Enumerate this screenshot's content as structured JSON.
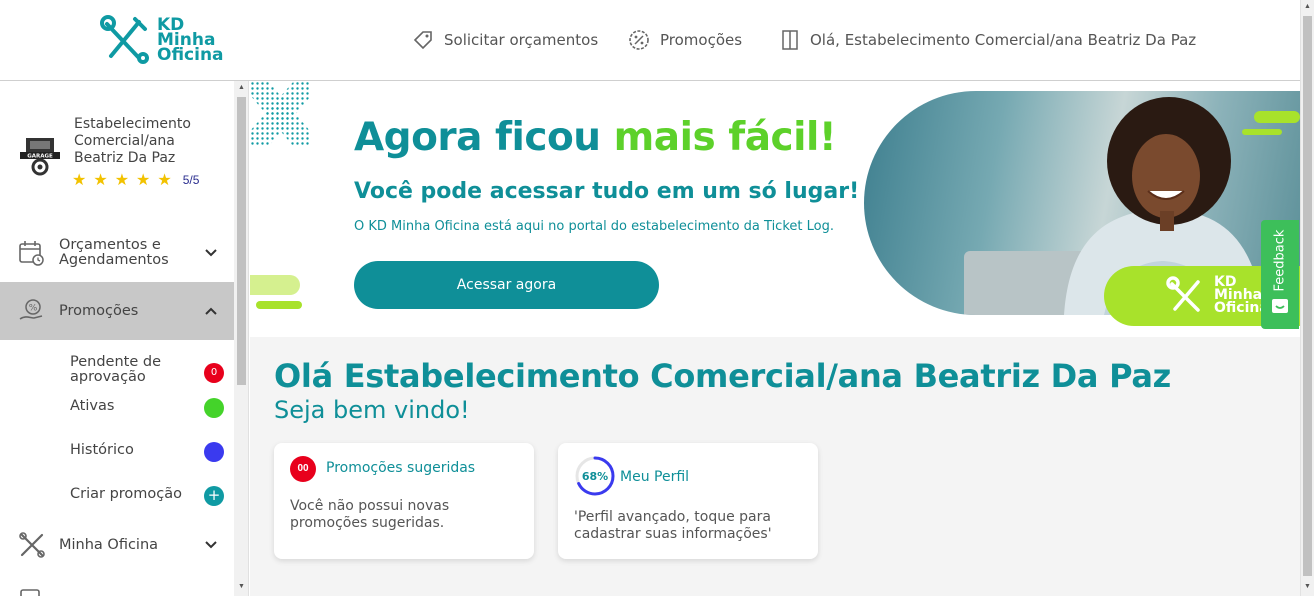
{
  "header": {
    "logo_text": "KD Minha Oficina",
    "nav": [
      {
        "label": "Solicitar orçamentos",
        "icon": "tag-icon"
      },
      {
        "label": "Promoções",
        "icon": "percent-badge-icon"
      },
      {
        "label": "Olá, Estabelecimento Comercial/ana Beatriz Da Paz",
        "icon": "door-icon"
      }
    ]
  },
  "sidebar": {
    "profile": {
      "name": "Estabelecimento Comercial/ana Beatriz Da Paz",
      "avatar_label": "GARAGE",
      "stars": 5,
      "rating": "5/5"
    },
    "menu": [
      {
        "label": "Orçamentos e Agendamentos",
        "icon": "calendar-icon",
        "expanded": false
      },
      {
        "label": "Promoções",
        "icon": "percent-hand-icon",
        "expanded": true
      },
      {
        "label": "Minha Oficina",
        "icon": "tools-icon",
        "expanded": false
      }
    ],
    "promo_sub": [
      {
        "label": "Pendente de aprovação",
        "badge": "0",
        "color": "#e8001c"
      },
      {
        "label": "Ativas",
        "color": "#44d32a"
      },
      {
        "label": "Histórico",
        "color": "#3a3aef"
      },
      {
        "label": "Criar promoção",
        "badge": "+",
        "color": "#0f9aa3"
      }
    ]
  },
  "banner": {
    "title_part1": "Agora ficou",
    "title_part2": "mais fácil!",
    "subtitle": "Você pode acessar tudo em um só lugar!",
    "description": "O KD Minha Oficina está aqui no portal do estabelecimento da Ticket Log.",
    "button": "Acessar agora",
    "photo_logo_text": "KD Minha Oficina"
  },
  "main": {
    "greeting": "Olá Estabelecimento Comercial/ana Beatriz Da Paz",
    "welcome": "Seja bem vindo!",
    "cards": [
      {
        "badge": "00",
        "title": "Promoções sugeridas",
        "text": "Você não possui novas promoções sugeridas."
      },
      {
        "progress_label": "68%",
        "progress": 0.68,
        "title": "Meu Perfil",
        "text": "'Perfil avançado, toque para cadastrar suas informações'"
      }
    ]
  },
  "feedback": {
    "label": "Feedback"
  },
  "colors": {
    "primary": "#0f8f98",
    "accent": "#5dd12a",
    "lime": "#a8e22b",
    "badge_red": "#e8001c"
  }
}
